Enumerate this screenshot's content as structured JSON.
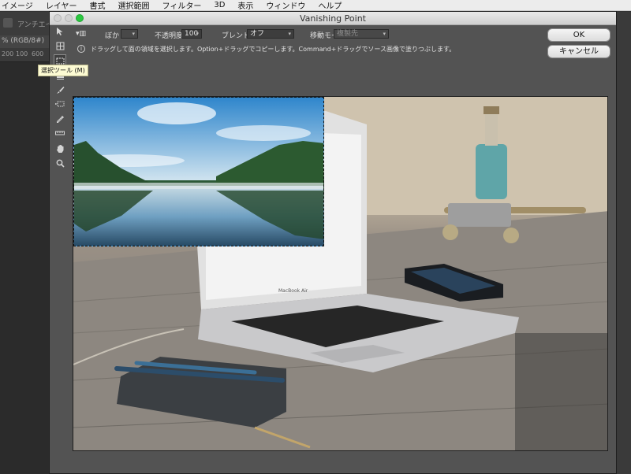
{
  "menubar": {
    "items": [
      "イメージ",
      "レイヤー",
      "書式",
      "選択範囲",
      "フィルター",
      "3D",
      "表示",
      "ウィンドウ",
      "ヘルプ"
    ]
  },
  "photoshop": {
    "option_text": "アンチエイリ",
    "tab_text": "% (RGB/8#)",
    "ruler_numbers": [
      "200",
      "100",
      "600"
    ]
  },
  "dialog": {
    "title": "Vanishing Point",
    "options": {
      "feather_label": "ぼかし：",
      "feather_value": "",
      "opacity_label": "不透明度：",
      "opacity_value": "100",
      "blend_label": "ブレンド：",
      "blend_value": "オフ",
      "move_mode_label": "移動モード：",
      "move_mode_value": "複製先"
    },
    "info_text": "ドラッグして面の領域を選択します。Option+ドラッグでコピーします。Command+ドラッグでソース画像で塗りつぶします。",
    "ok_label": "OK",
    "cancel_label": "キャンセル",
    "tooltip": "選択ツール (M)",
    "tools": [
      {
        "name": "edit-plane-tool",
        "icon": "arrow-icon",
        "active": false
      },
      {
        "name": "create-plane-tool",
        "icon": "grid-icon",
        "active": false
      },
      {
        "name": "marquee-tool",
        "icon": "marquee-icon",
        "active": true
      },
      {
        "name": "stamp-tool",
        "icon": "stamp-icon",
        "active": false
      },
      {
        "name": "brush-tool",
        "icon": "brush-icon",
        "active": false
      },
      {
        "name": "transform-tool",
        "icon": "transform-icon",
        "active": false
      },
      {
        "name": "eyedropper-tool",
        "icon": "eyedropper-icon",
        "active": false
      },
      {
        "name": "measure-tool",
        "icon": "ruler-icon",
        "active": false
      },
      {
        "name": "hand-tool",
        "icon": "hand-icon",
        "active": false
      },
      {
        "name": "zoom-tool",
        "icon": "zoom-icon",
        "active": false
      }
    ]
  },
  "canvas": {
    "laptop_brand": "MacBook Air"
  },
  "colors": {
    "dialog_bg": "#535353",
    "zoom_button": "#2bc840",
    "tooltip_bg": "#fdfbd3"
  }
}
